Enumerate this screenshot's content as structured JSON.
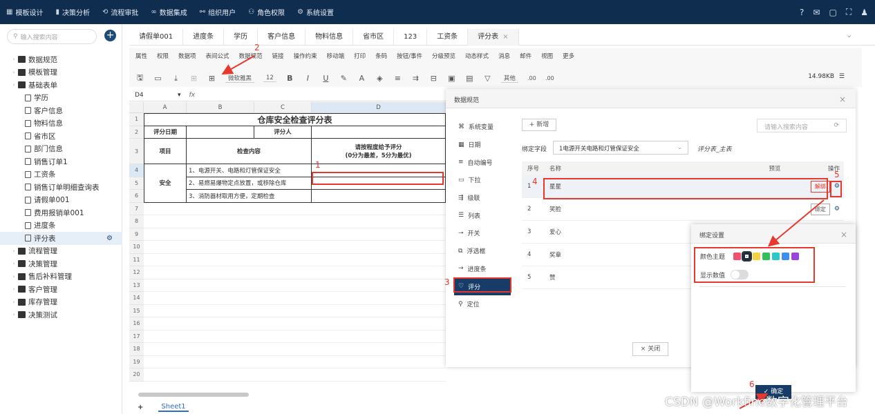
{
  "topnav": {
    "items": [
      {
        "icon": "grid-icon",
        "glyph": "▦",
        "label": "模板设计"
      },
      {
        "icon": "bar-chart-icon",
        "glyph": "▮",
        "label": "决策分析"
      },
      {
        "icon": "workflow-icon",
        "glyph": "⟲",
        "label": "流程审批"
      },
      {
        "icon": "link-icon",
        "glyph": "∞",
        "label": "数据集成"
      },
      {
        "icon": "org-icon",
        "glyph": "⚯",
        "label": "组织用户"
      },
      {
        "icon": "user-icon",
        "glyph": "⚇",
        "label": "角色权限"
      },
      {
        "icon": "gear-icon",
        "glyph": "⚙",
        "label": "系统设置"
      }
    ],
    "right_icons": [
      "?",
      "✉",
      "▢",
      "⛶",
      "♟"
    ]
  },
  "sidebar": {
    "search_placeholder": "输入搜索内容",
    "items": [
      {
        "label": "数据规范",
        "type": "folder",
        "level": 0
      },
      {
        "label": "模板管理",
        "type": "folder",
        "level": 0
      },
      {
        "label": "基础表单",
        "type": "folder",
        "level": 0
      },
      {
        "label": "学历",
        "type": "doc",
        "level": 1
      },
      {
        "label": "客户信息",
        "type": "doc",
        "level": 1
      },
      {
        "label": "物料信息",
        "type": "doc",
        "level": 1
      },
      {
        "label": "省市区",
        "type": "doc",
        "level": 1
      },
      {
        "label": "部门信息",
        "type": "doc",
        "level": 1
      },
      {
        "label": "销售订单1",
        "type": "doc",
        "level": 1
      },
      {
        "label": "工资条",
        "type": "doc",
        "level": 1
      },
      {
        "label": "销售订单明细查询表",
        "type": "doc",
        "level": 1
      },
      {
        "label": "请假单001",
        "type": "doc",
        "level": 1
      },
      {
        "label": "费用报销单001",
        "type": "doc",
        "level": 1
      },
      {
        "label": "进度条",
        "type": "doc",
        "level": 1
      },
      {
        "label": "评分表",
        "type": "doc",
        "level": 1,
        "selected": true
      },
      {
        "label": "流程管理",
        "type": "folder",
        "level": 0
      },
      {
        "label": "决策管理",
        "type": "folder",
        "level": 0
      },
      {
        "label": "售后补料管理",
        "type": "folder",
        "level": 0
      },
      {
        "label": "客户管理",
        "type": "folder",
        "level": 0
      },
      {
        "label": "库存管理",
        "type": "folder",
        "level": 0
      },
      {
        "label": "决策测试",
        "type": "folder",
        "level": 0
      }
    ]
  },
  "tabs": [
    "请假单001",
    "进度条",
    "学历",
    "客户信息",
    "物料信息",
    "省市区",
    "123",
    "工资条",
    "评分表"
  ],
  "active_tab": "评分表",
  "ribbon": {
    "menu": [
      "属性",
      "权限",
      "数据项",
      "表间公式",
      "数据规范",
      "链接",
      "操作约束",
      "移动端",
      "打印",
      "条码",
      "按钮/事件",
      "分级预览",
      "动态样式",
      "消息",
      "邮件",
      "视图",
      "更多"
    ],
    "font": "微软雅黑",
    "font_size": "12",
    "number_format": "其他",
    "file_size": "14.98KB"
  },
  "formula_bar": {
    "cell_ref": "D4",
    "fx": "fx"
  },
  "sheet": {
    "columns": [
      "A",
      "B",
      "C",
      "D"
    ],
    "rows": [
      "1",
      "2",
      "3",
      "4",
      "5",
      "6",
      "7",
      "8",
      "9",
      "10",
      "11",
      "12",
      "13",
      "14",
      "15",
      "16",
      "17",
      "18",
      "19",
      "20"
    ],
    "title": "仓库安全检查评分表",
    "date_label": "评分日期",
    "rater_label": "评分人",
    "item_header": "项目",
    "content_header": "检查内容",
    "score_header_line1": "请按程度给予评分",
    "score_header_line2": "(0分为最差，5分为最优)",
    "category": "安全",
    "items": [
      "1、电源开关、电路和灯管保证安全",
      "2、易燃易爆物定点放置，或移除仓库",
      "3、消防器材取用方便，定期检查"
    ],
    "sheet_tab": "Sheet1",
    "add_sheet": "+"
  },
  "spec_modal": {
    "title": "数据规范",
    "categories": [
      {
        "icon": "variable-icon",
        "glyph": "⌘",
        "label": "系统变量"
      },
      {
        "icon": "calendar-icon",
        "glyph": "▦",
        "label": "日期"
      },
      {
        "icon": "number-list-icon",
        "glyph": "≡",
        "label": "自动编号"
      },
      {
        "icon": "dropdown-icon",
        "glyph": "▭",
        "label": "下拉"
      },
      {
        "icon": "cascade-icon",
        "glyph": "⇶",
        "label": "级联"
      },
      {
        "icon": "list-icon",
        "glyph": "☰",
        "label": "列表"
      },
      {
        "icon": "switch-icon",
        "glyph": "⊸",
        "label": "开关"
      },
      {
        "icon": "float-box-icon",
        "glyph": "⧉",
        "label": "浮选框"
      },
      {
        "icon": "progress-icon",
        "glyph": "→",
        "label": "进度条"
      },
      {
        "icon": "heart-icon",
        "glyph": "♡",
        "label": "评分"
      },
      {
        "icon": "location-icon",
        "glyph": "⚲",
        "label": "定位"
      }
    ],
    "active_category": "评分",
    "new_button": "+ 新增",
    "search_placeholder": "请输入搜索内容",
    "bind_field_label": "绑定字段",
    "bind_field_value": "1电源开关电路和灯管保证安全",
    "bind_sheet": "评分表_主表",
    "table_headers": [
      "序号",
      "名称",
      "预览",
      "操作"
    ],
    "rows": [
      {
        "no": "1",
        "name": "星星",
        "action": "解绑",
        "selected": true
      },
      {
        "no": "2",
        "name": "笑脸",
        "action": "绑定"
      },
      {
        "no": "3",
        "name": "爱心",
        "action": ""
      },
      {
        "no": "4",
        "name": "奖章",
        "action": ""
      },
      {
        "no": "5",
        "name": "赞",
        "action": ""
      }
    ],
    "close_button": "× 关闭"
  },
  "bind_dialog": {
    "title": "绑定设置",
    "color_theme_label": "颜色主题",
    "colors": [
      "#f0506e",
      "#1a2b45",
      "#f5d142",
      "#32c05a",
      "#2cc8c8",
      "#3d8ef0",
      "#9b45e0"
    ],
    "selected_color_index": 1,
    "show_value_label": "显示数值",
    "show_value": false,
    "confirm_button": "✓ 确定"
  },
  "annotations": [
    "1",
    "2",
    "3",
    "4",
    "5",
    "6"
  ],
  "accent": "#173c68",
  "highlight": "#e8372c",
  "watermark": "CSDN @Workfine数字化管理平台"
}
